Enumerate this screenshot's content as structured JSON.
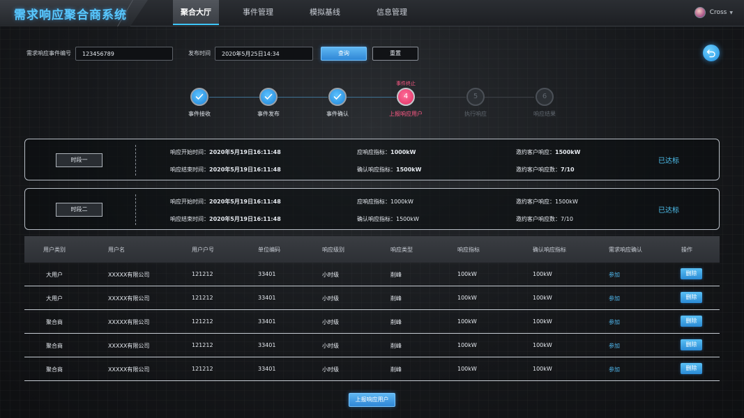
{
  "header": {
    "app_title": "需求响应聚合商系统",
    "nav": [
      {
        "label": "聚合大厅",
        "active": true
      },
      {
        "label": "事件管理",
        "active": false
      },
      {
        "label": "模拟基线",
        "active": false
      },
      {
        "label": "信息管理",
        "active": false
      }
    ],
    "user_name": "Cross"
  },
  "search": {
    "event_id_label": "需求响应事件编号",
    "event_id_value": "123456789",
    "publish_time_label": "发布时间",
    "publish_time_value": "2020年5月25日14:34",
    "query_label": "查询",
    "reset_label": "重置"
  },
  "steps": {
    "current_note": "事件终止",
    "items": [
      {
        "label": "事件接收",
        "state": "done",
        "num": "1"
      },
      {
        "label": "事件发布",
        "state": "done",
        "num": "2"
      },
      {
        "label": "事件确认",
        "state": "done",
        "num": "3"
      },
      {
        "label": "上报响应用户",
        "state": "current",
        "num": "4"
      },
      {
        "label": "执行响应",
        "state": "pending",
        "num": "5"
      },
      {
        "label": "响应结果",
        "state": "pending",
        "num": "6"
      }
    ]
  },
  "periods": [
    {
      "tag": "时段一",
      "start_label": "响应开始时间：",
      "start_value": "2020年5月19日16:11:48",
      "end_label": "响应结束时间：",
      "end_value": "2020年5月19日16:11:48",
      "target_label": "应响应指标：",
      "target_value": "1000kW",
      "confirm_label": "确认响应指标：",
      "confirm_value": "1500kW",
      "invite_label": "邀约客户响应：",
      "invite_value": "1500kW",
      "count_label": "邀约客户响应数：",
      "count_value": "7/10",
      "status": "已达标"
    },
    {
      "tag": "时段二",
      "start_label": "响应开始时间：",
      "start_value": "2020年5月19日16:11:48",
      "end_label": "响应结束时间：",
      "end_value": "2020年5月19日16:11:48",
      "target_label": "应响应指标：",
      "target_value": "1000kW",
      "confirm_label": "确认响应指标：",
      "confirm_value": "1500kW",
      "invite_label": "邀约客户响应：",
      "invite_value": "1500kW",
      "count_label": "邀约客户响应数：",
      "count_value": "7/10",
      "status": "已达标"
    }
  ],
  "table": {
    "headers": [
      "用户类别",
      "用户名",
      "用户户号",
      "单位编码",
      "响应级别",
      "响应类型",
      "响应指标",
      "确认响应指标",
      "需求响应确认",
      "操作"
    ],
    "rows": [
      {
        "category": "大用户",
        "name": "XXXXX有限公司",
        "account": "121212",
        "unit_code": "33401",
        "level": "小时级",
        "type": "削峰",
        "target": "100kW",
        "confirm_target": "100kW",
        "confirm": "参加",
        "action": "删除"
      },
      {
        "category": "大用户",
        "name": "XXXXX有限公司",
        "account": "121212",
        "unit_code": "33401",
        "level": "小时级",
        "type": "削峰",
        "target": "100kW",
        "confirm_target": "100kW",
        "confirm": "参加",
        "action": "删除"
      },
      {
        "category": "聚合商",
        "name": "XXXXX有限公司",
        "account": "121212",
        "unit_code": "33401",
        "level": "小时级",
        "type": "削峰",
        "target": "100kW",
        "confirm_target": "100kW",
        "confirm": "参加",
        "action": "删除"
      },
      {
        "category": "聚合商",
        "name": "XXXXX有限公司",
        "account": "121212",
        "unit_code": "33401",
        "level": "小时级",
        "type": "削峰",
        "target": "100kW",
        "confirm_target": "100kW",
        "confirm": "参加",
        "action": "删除"
      },
      {
        "category": "聚合商",
        "name": "XXXXX有限公司",
        "account": "121212",
        "unit_code": "33401",
        "level": "小时级",
        "type": "削峰",
        "target": "100kW",
        "confirm_target": "100kW",
        "confirm": "参加",
        "action": "删除"
      }
    ]
  },
  "footer": {
    "submit_label": "上报响应用户"
  }
}
